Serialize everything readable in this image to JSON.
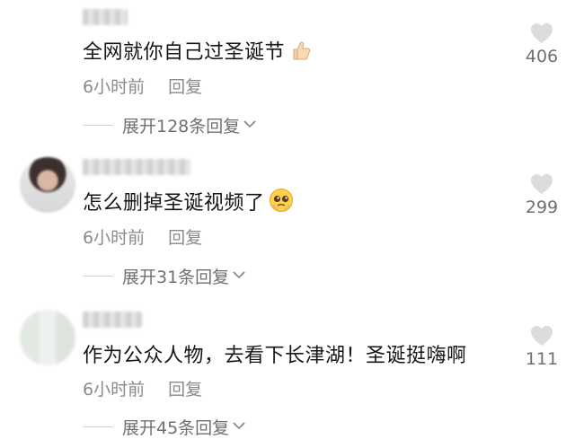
{
  "comments": [
    {
      "text": "全网就你自己过圣诞节",
      "emoji": "thumbs-up-icon",
      "time": "6小时前",
      "reply_label": "回复",
      "expand_label": "展开128条回复",
      "likes": "406"
    },
    {
      "text": "怎么删掉圣诞视频了",
      "emoji": "pleading-face-icon",
      "time": "6小时前",
      "reply_label": "回复",
      "expand_label": "展开31条回复",
      "likes": "299"
    },
    {
      "text": "作为公众人物，去看下长津湖！圣诞挺嗨啊",
      "emoji": "",
      "time": "6小时前",
      "reply_label": "回复",
      "expand_label": "展开45条回复",
      "likes": "111"
    }
  ],
  "colors": {
    "heart": "#dcdcdc",
    "meta": "#8a8a8a",
    "expand": "#6f6f6f"
  }
}
